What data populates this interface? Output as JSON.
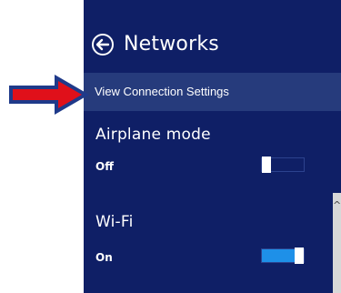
{
  "header": {
    "title": "Networks",
    "back_icon": "back-arrow-circle-icon"
  },
  "connection_settings": {
    "label": "View Connection Settings"
  },
  "airplane_mode": {
    "label": "Airplane mode",
    "state": "Off",
    "value": 0
  },
  "wifi": {
    "label": "Wi-Fi",
    "state": "On",
    "value": 1
  },
  "colors": {
    "panel_bg": "#0f1f66",
    "highlight_bg": "#263b7c",
    "toggle_on": "#1e90e8",
    "annotation_arrow": "#e0101a",
    "annotation_outline": "#1f3a8a"
  }
}
